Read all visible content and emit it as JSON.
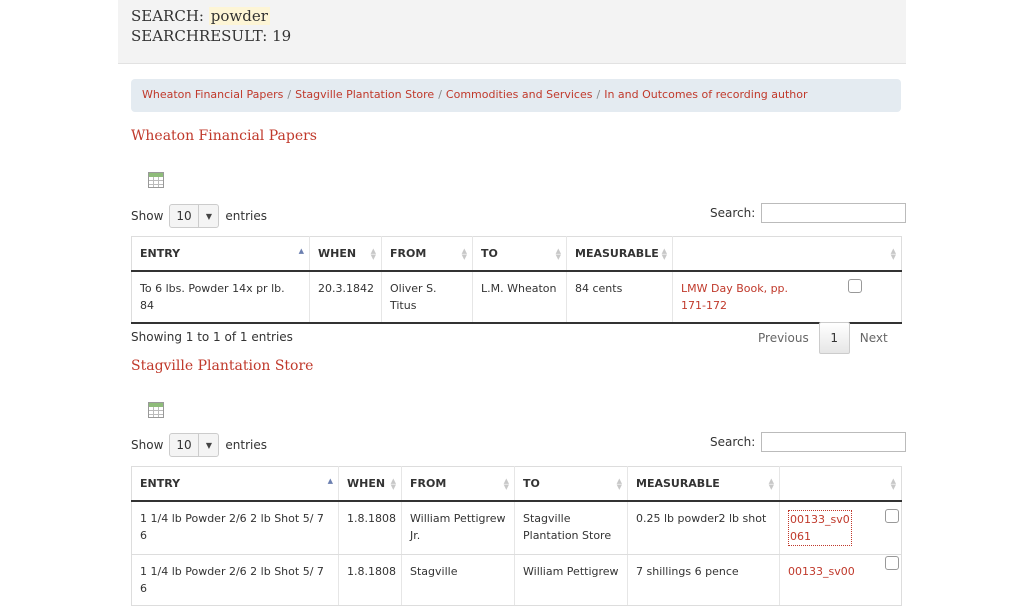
{
  "search": {
    "label": "SEARCH:",
    "term": "powder",
    "result_label": "SEARCHRESULT: 19"
  },
  "breadcrumb": [
    "Wheaton Financial Papers",
    "Stagville Plantation Store",
    "Commodities and Services",
    "In and Outcomes of recording author"
  ],
  "breadcrumb_separator": "/",
  "icons": {
    "export": "spreadsheet-icon",
    "sort_asc": "sort-ascending-icon",
    "sort_both": "sort-icon",
    "dropdown": "chevron-down-icon"
  },
  "colors": {
    "link": "#c0392b",
    "breadcrumb_bg": "#e4ebf1",
    "header_bg": "#f3f3f3"
  },
  "table1": {
    "title": "Wheaton Financial Papers",
    "show_label": "Show",
    "length_value": "10",
    "entries_label": "entries",
    "search_label": "Search:",
    "columns": [
      "ENTRY",
      "WHEN",
      "FROM",
      "TO",
      "MEASURABLE",
      ""
    ],
    "rows": [
      {
        "entry": "To 6 lbs. Powder 14x pr lb. 84",
        "when": "20.3.1842",
        "from": "Oliver S. Titus",
        "to": "L.M. Wheaton",
        "measurable": "84 cents",
        "source": "LMW Day Book, pp. 171-172"
      }
    ],
    "info": "Showing 1 to 1 of 1 entries",
    "pager": {
      "previous": "Previous",
      "current": "1",
      "next": "Next"
    }
  },
  "table2": {
    "title": "Stagville Plantation Store",
    "show_label": "Show",
    "length_value": "10",
    "entries_label": "entries",
    "search_label": "Search:",
    "columns": [
      "ENTRY",
      "WHEN",
      "FROM",
      "TO",
      "MEASURABLE",
      ""
    ],
    "rows": [
      {
        "entry": "1 1/4 lb Powder 2/6 2 lb Shot 5/ 7 6",
        "when": "1.8.1808",
        "from": "William Pettigrew Jr.",
        "to": "Stagville Plantation Store",
        "measurable": "0.25 lb powder2 lb shot",
        "source": "00133_sv0061"
      },
      {
        "entry": "1 1/4 lb Powder 2/6 2 lb Shot 5/ 7 6",
        "when": "1.8.1808",
        "from": "Stagville",
        "to": "William Pettigrew",
        "measurable": "7 shillings 6 pence",
        "source": "00133_sv00"
      }
    ]
  }
}
